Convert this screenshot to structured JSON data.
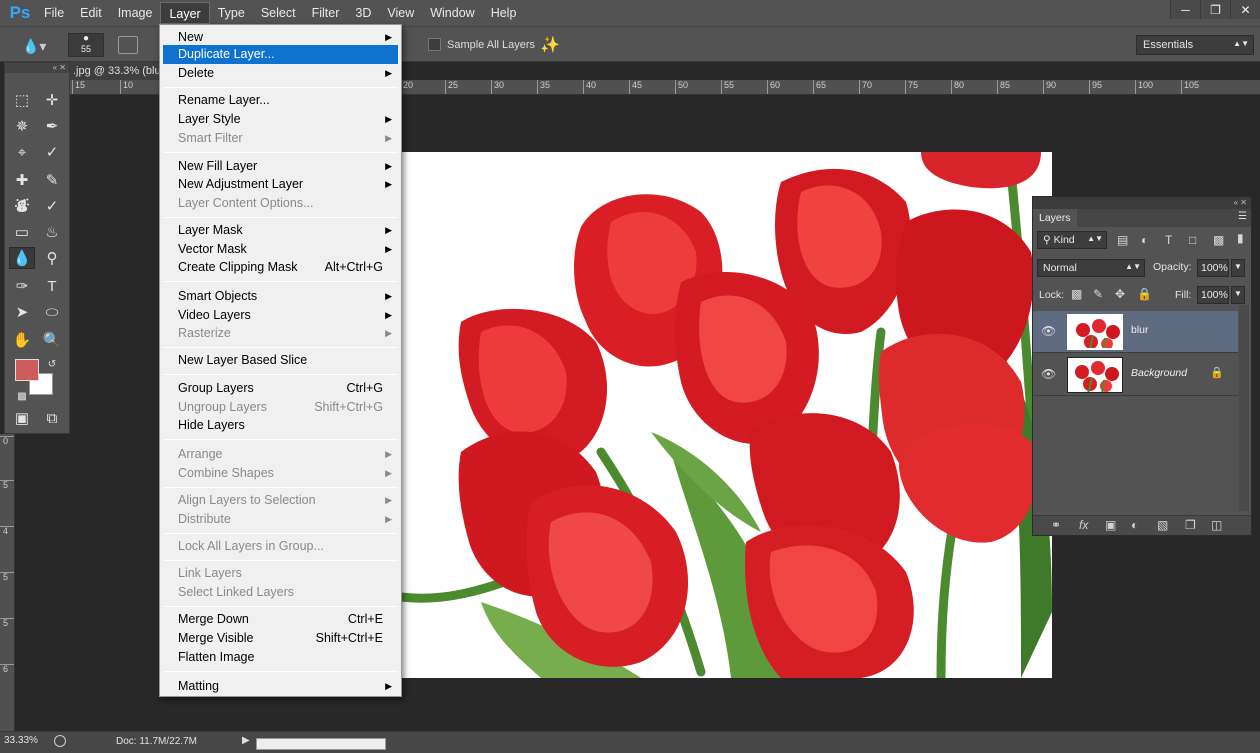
{
  "app": {
    "logo": "Ps",
    "menus": [
      "File",
      "Edit",
      "Image",
      "Layer",
      "Type",
      "Select",
      "Filter",
      "3D",
      "View",
      "Window",
      "Help"
    ],
    "active_menu": "Layer",
    "window_controls": [
      "minimize-icon",
      "restore-icon",
      "close-icon"
    ]
  },
  "options_bar": {
    "brush_size": "55",
    "sample_all_layers_label": "Sample All Layers",
    "sample_all_layers_checked": false,
    "workspace": "Essentials"
  },
  "toolbar": {
    "foreground_color": "#cd5c5c",
    "background_color": "#ffffff",
    "tools": [
      "marquee-icon",
      "move-icon",
      "lasso-icon",
      "quick-select-icon",
      "crop-icon",
      "eyedropper-icon",
      "healing-brush-icon",
      "brush-icon",
      "clone-stamp-icon",
      "history-brush-icon",
      "eraser-icon",
      "paint-bucket-icon",
      "blur-tool-icon",
      "zoom-tool-icon",
      "pen-icon",
      "type-icon",
      "path-select-icon",
      "ellipse-icon",
      "hand-icon",
      "zoom-icon"
    ],
    "selected_tool": "blur-tool-icon"
  },
  "document": {
    "tab_title": ".jpg @ 33.3% (blu",
    "ruler_h": [
      "15",
      "10",
      "20",
      "25",
      "30",
      "35",
      "40",
      "45",
      "50",
      "55",
      "60",
      "65",
      "70",
      "75",
      "80",
      "85",
      "90",
      "95",
      "100",
      "105"
    ],
    "ruler_v": [
      "0",
      "5",
      "4",
      "5",
      "5",
      "6"
    ]
  },
  "layer_menu": {
    "items": [
      {
        "label": "New",
        "submenu": true,
        "enabled": true
      },
      {
        "label": "Duplicate Layer...",
        "enabled": true,
        "highlighted": true
      },
      {
        "label": "Delete",
        "submenu": true,
        "enabled": true
      },
      {
        "separator": true
      },
      {
        "label": "Rename Layer...",
        "enabled": true
      },
      {
        "label": "Layer Style",
        "submenu": true,
        "enabled": true
      },
      {
        "label": "Smart Filter",
        "submenu": true,
        "enabled": false
      },
      {
        "separator": true
      },
      {
        "label": "New Fill Layer",
        "submenu": true,
        "enabled": true
      },
      {
        "label": "New Adjustment Layer",
        "submenu": true,
        "enabled": true
      },
      {
        "label": "Layer Content Options...",
        "enabled": false
      },
      {
        "separator": true
      },
      {
        "label": "Layer Mask",
        "submenu": true,
        "enabled": true
      },
      {
        "label": "Vector Mask",
        "submenu": true,
        "enabled": true
      },
      {
        "label": "Create Clipping Mask",
        "shortcut": "Alt+Ctrl+G",
        "enabled": true
      },
      {
        "separator": true
      },
      {
        "label": "Smart Objects",
        "submenu": true,
        "enabled": true
      },
      {
        "label": "Video Layers",
        "submenu": true,
        "enabled": true
      },
      {
        "label": "Rasterize",
        "submenu": true,
        "enabled": false
      },
      {
        "separator": true
      },
      {
        "label": "New Layer Based Slice",
        "enabled": true
      },
      {
        "separator": true
      },
      {
        "label": "Group Layers",
        "shortcut": "Ctrl+G",
        "enabled": true
      },
      {
        "label": "Ungroup Layers",
        "shortcut": "Shift+Ctrl+G",
        "enabled": false
      },
      {
        "label": "Hide Layers",
        "enabled": true
      },
      {
        "separator": true
      },
      {
        "label": "Arrange",
        "submenu": true,
        "enabled": false
      },
      {
        "label": "Combine Shapes",
        "submenu": true,
        "enabled": false
      },
      {
        "separator": true
      },
      {
        "label": "Align Layers to Selection",
        "submenu": true,
        "enabled": false
      },
      {
        "label": "Distribute",
        "submenu": true,
        "enabled": false
      },
      {
        "separator": true
      },
      {
        "label": "Lock All Layers in Group...",
        "enabled": false
      },
      {
        "separator": true
      },
      {
        "label": "Link Layers",
        "enabled": false
      },
      {
        "label": "Select Linked Layers",
        "enabled": false
      },
      {
        "separator": true
      },
      {
        "label": "Merge Down",
        "shortcut": "Ctrl+E",
        "enabled": true
      },
      {
        "label": "Merge Visible",
        "shortcut": "Shift+Ctrl+E",
        "enabled": true
      },
      {
        "label": "Flatten Image",
        "enabled": true
      },
      {
        "separator": true
      },
      {
        "label": "Matting",
        "submenu": true,
        "enabled": true
      }
    ]
  },
  "layers_panel": {
    "tab": "Layers",
    "filter_kind": "Kind",
    "blend_mode": "Normal",
    "opacity_label": "Opacity:",
    "opacity": "100%",
    "lock_label": "Lock:",
    "fill_label": "Fill:",
    "fill": "100%",
    "layers": [
      {
        "name": "blur",
        "selected": true,
        "visible": true,
        "locked": false
      },
      {
        "name": "Background",
        "selected": false,
        "visible": true,
        "locked": true
      }
    ],
    "footer_icons": [
      "link-icon",
      "fx-icon",
      "mask-icon",
      "adjustment-icon",
      "folder-icon",
      "new-layer-icon",
      "trash-icon"
    ]
  },
  "status_bar": {
    "zoom": "33.33%",
    "doc_info": "Doc: 11.7M/22.7M"
  }
}
